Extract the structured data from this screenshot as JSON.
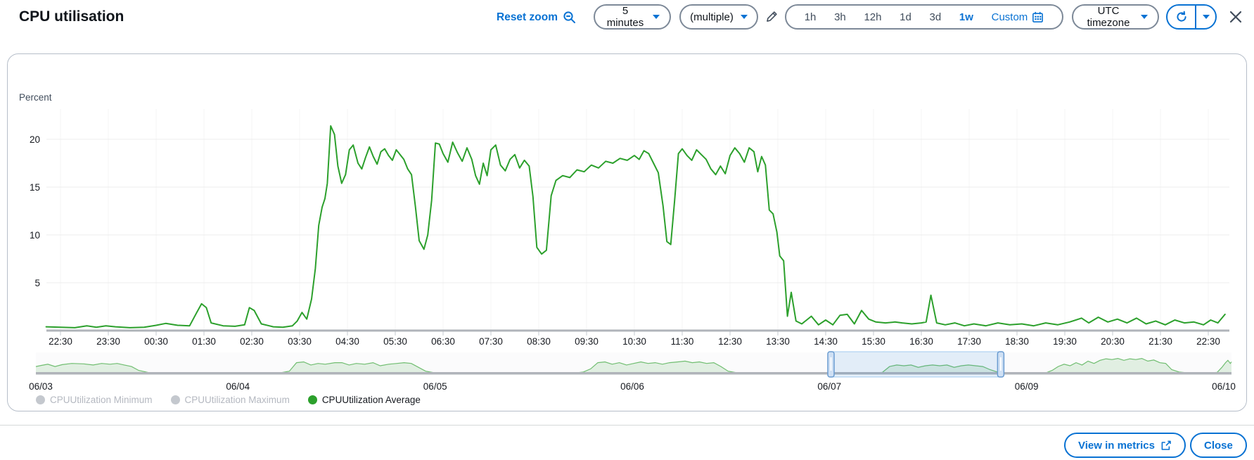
{
  "header": {
    "title": "CPU utilisation",
    "reset_zoom_label": "Reset zoom",
    "period_value": "5 minutes",
    "metric_value": "(multiple)",
    "time_ranges": [
      "1h",
      "3h",
      "12h",
      "1d",
      "3d",
      "1w"
    ],
    "active_time_range": "1w",
    "custom_label": "Custom",
    "timezone_value": "UTC timezone"
  },
  "chart_data": {
    "type": "line",
    "title": "CPU utilisation",
    "ylabel": "Percent",
    "y_ticks": [
      5,
      10,
      15,
      20
    ],
    "ylim": [
      0,
      27
    ],
    "grid": true,
    "legend_position": "bottom",
    "x_hours_range": [
      -0.3,
      24.35
    ],
    "x_tick_labels": [
      "22:30",
      "23:30",
      "00:30",
      "01:30",
      "02:30",
      "03:30",
      "04:30",
      "05:30",
      "06:30",
      "07:30",
      "08:30",
      "09:30",
      "10:30",
      "11:30",
      "12:30",
      "13:30",
      "14:30",
      "15:30",
      "16:30",
      "17:30",
      "18:30",
      "19:30",
      "20:30",
      "21:30",
      "22:30"
    ],
    "series": [
      {
        "name": "CPUUtilization Average",
        "unit": "Percent",
        "color": "#2ca02c",
        "points": [
          [
            -0.3,
            0.4
          ],
          [
            0,
            0.35
          ],
          [
            0.3,
            0.3
          ],
          [
            0.55,
            0.5
          ],
          [
            0.75,
            0.35
          ],
          [
            0.95,
            0.5
          ],
          [
            1.15,
            0.4
          ],
          [
            1.45,
            0.3
          ],
          [
            1.75,
            0.35
          ],
          [
            2,
            0.55
          ],
          [
            2.2,
            0.75
          ],
          [
            2.45,
            0.55
          ],
          [
            2.7,
            0.5
          ],
          [
            2.85,
            1.9
          ],
          [
            2.95,
            2.8
          ],
          [
            3.05,
            2.4
          ],
          [
            3.15,
            0.8
          ],
          [
            3.4,
            0.5
          ],
          [
            3.65,
            0.45
          ],
          [
            3.85,
            0.6
          ],
          [
            3.95,
            2.4
          ],
          [
            4.05,
            2.1
          ],
          [
            4.2,
            0.7
          ],
          [
            4.45,
            0.4
          ],
          [
            4.65,
            0.35
          ],
          [
            4.85,
            0.5
          ],
          [
            4.95,
            1
          ],
          [
            5.05,
            1.9
          ],
          [
            5.15,
            1.2
          ],
          [
            5.25,
            3.3
          ],
          [
            5.33,
            6.5
          ],
          [
            5.4,
            11
          ],
          [
            5.47,
            12.9
          ],
          [
            5.53,
            13.8
          ],
          [
            5.58,
            15.4
          ],
          [
            5.65,
            21.4
          ],
          [
            5.73,
            20.5
          ],
          [
            5.8,
            17.2
          ],
          [
            5.88,
            15.4
          ],
          [
            5.96,
            16.3
          ],
          [
            6.04,
            18.9
          ],
          [
            6.12,
            19.4
          ],
          [
            6.22,
            17.5
          ],
          [
            6.3,
            16.9
          ],
          [
            6.38,
            18.1
          ],
          [
            6.46,
            19.2
          ],
          [
            6.54,
            18.2
          ],
          [
            6.62,
            17.4
          ],
          [
            6.7,
            18.7
          ],
          [
            6.78,
            19
          ],
          [
            6.86,
            18.3
          ],
          [
            6.94,
            17.8
          ],
          [
            7.02,
            18.9
          ],
          [
            7.1,
            18.4
          ],
          [
            7.18,
            17.9
          ],
          [
            7.26,
            16.9
          ],
          [
            7.34,
            16.3
          ],
          [
            7.42,
            13
          ],
          [
            7.5,
            9.4
          ],
          [
            7.6,
            8.5
          ],
          [
            7.68,
            10
          ],
          [
            7.76,
            13.6
          ],
          [
            7.84,
            19.6
          ],
          [
            7.92,
            19.5
          ],
          [
            8,
            18.5
          ],
          [
            8.1,
            17.6
          ],
          [
            8.2,
            19.7
          ],
          [
            8.3,
            18.6
          ],
          [
            8.4,
            17.7
          ],
          [
            8.5,
            19.1
          ],
          [
            8.6,
            17.9
          ],
          [
            8.68,
            16.2
          ],
          [
            8.76,
            15.3
          ],
          [
            8.84,
            17.5
          ],
          [
            8.92,
            16.2
          ],
          [
            9,
            18.9
          ],
          [
            9.1,
            19.4
          ],
          [
            9.2,
            17.3
          ],
          [
            9.3,
            16.7
          ],
          [
            9.4,
            17.9
          ],
          [
            9.5,
            18.4
          ],
          [
            9.6,
            17
          ],
          [
            9.7,
            17.8
          ],
          [
            9.8,
            17.2
          ],
          [
            9.88,
            14
          ],
          [
            9.96,
            8.7
          ],
          [
            10.06,
            8
          ],
          [
            10.16,
            8.4
          ],
          [
            10.26,
            14.1
          ],
          [
            10.36,
            15.7
          ],
          [
            10.5,
            16.2
          ],
          [
            10.65,
            16
          ],
          [
            10.8,
            16.8
          ],
          [
            10.95,
            16.6
          ],
          [
            11.1,
            17.3
          ],
          [
            11.25,
            17
          ],
          [
            11.4,
            17.7
          ],
          [
            11.55,
            17.5
          ],
          [
            11.7,
            18
          ],
          [
            11.85,
            17.8
          ],
          [
            12,
            18.3
          ],
          [
            12.1,
            17.9
          ],
          [
            12.2,
            18.8
          ],
          [
            12.3,
            18.5
          ],
          [
            12.4,
            17.5
          ],
          [
            12.5,
            16.5
          ],
          [
            12.6,
            13
          ],
          [
            12.68,
            9.3
          ],
          [
            12.76,
            9
          ],
          [
            12.84,
            13.5
          ],
          [
            12.92,
            18.5
          ],
          [
            13,
            19
          ],
          [
            13.1,
            18.3
          ],
          [
            13.2,
            17.8
          ],
          [
            13.3,
            18.9
          ],
          [
            13.4,
            18.4
          ],
          [
            13.5,
            17.9
          ],
          [
            13.6,
            16.9
          ],
          [
            13.7,
            16.3
          ],
          [
            13.8,
            17.2
          ],
          [
            13.9,
            16.4
          ],
          [
            14,
            18.3
          ],
          [
            14.1,
            19.1
          ],
          [
            14.2,
            18.5
          ],
          [
            14.3,
            17.6
          ],
          [
            14.4,
            19.1
          ],
          [
            14.5,
            18.7
          ],
          [
            14.58,
            16.6
          ],
          [
            14.66,
            18.2
          ],
          [
            14.74,
            17.3
          ],
          [
            14.82,
            12.6
          ],
          [
            14.9,
            12.2
          ],
          [
            14.98,
            10.3
          ],
          [
            15.04,
            7.8
          ],
          [
            15.12,
            7.3
          ],
          [
            15.2,
            1.5
          ],
          [
            15.28,
            4
          ],
          [
            15.38,
            1
          ],
          [
            15.5,
            0.7
          ],
          [
            15.7,
            1.5
          ],
          [
            15.85,
            0.6
          ],
          [
            16,
            1.1
          ],
          [
            16.15,
            0.6
          ],
          [
            16.3,
            1.6
          ],
          [
            16.45,
            1.7
          ],
          [
            16.6,
            0.7
          ],
          [
            16.75,
            2.1
          ],
          [
            16.9,
            1.2
          ],
          [
            17.05,
            0.9
          ],
          [
            17.25,
            0.8
          ],
          [
            17.45,
            0.9
          ],
          [
            17.6,
            0.8
          ],
          [
            17.8,
            0.7
          ],
          [
            18,
            0.8
          ],
          [
            18.1,
            0.9
          ],
          [
            18.2,
            3.7
          ],
          [
            18.32,
            0.8
          ],
          [
            18.5,
            0.6
          ],
          [
            18.7,
            0.8
          ],
          [
            18.9,
            0.5
          ],
          [
            19.1,
            0.7
          ],
          [
            19.35,
            0.5
          ],
          [
            19.6,
            0.8
          ],
          [
            19.85,
            0.6
          ],
          [
            20.1,
            0.7
          ],
          [
            20.35,
            0.5
          ],
          [
            20.6,
            0.8
          ],
          [
            20.85,
            0.6
          ],
          [
            21.1,
            0.9
          ],
          [
            21.35,
            1.3
          ],
          [
            21.5,
            0.8
          ],
          [
            21.7,
            1.4
          ],
          [
            21.9,
            0.9
          ],
          [
            22.1,
            1.2
          ],
          [
            22.3,
            0.8
          ],
          [
            22.5,
            1.3
          ],
          [
            22.7,
            0.7
          ],
          [
            22.9,
            1
          ],
          [
            23.1,
            0.6
          ],
          [
            23.3,
            1.1
          ],
          [
            23.5,
            0.8
          ],
          [
            23.7,
            0.9
          ],
          [
            23.9,
            0.6
          ],
          [
            24.05,
            1.1
          ],
          [
            24.2,
            0.8
          ],
          [
            24.35,
            1.7
          ]
        ]
      }
    ],
    "timeline": {
      "date_labels": [
        "06/03",
        "06/04",
        "06/05",
        "06/06",
        "06/07",
        "06/09",
        "06/10"
      ],
      "selected_range_fracs": [
        0.665,
        0.807
      ],
      "sparkline_points": [
        [
          0,
          9
        ],
        [
          0.005,
          10.5
        ],
        [
          0.01,
          12
        ],
        [
          0.016,
          9
        ],
        [
          0.022,
          11.5
        ],
        [
          0.03,
          13
        ],
        [
          0.04,
          12.5
        ],
        [
          0.048,
          11
        ],
        [
          0.055,
          13
        ],
        [
          0.062,
          12
        ],
        [
          0.068,
          13
        ],
        [
          0.074,
          11
        ],
        [
          0.08,
          9
        ],
        [
          0.086,
          4
        ],
        [
          0.095,
          1
        ],
        [
          0.12,
          0.5
        ],
        [
          0.18,
          0.5
        ],
        [
          0.205,
          1
        ],
        [
          0.212,
          3
        ],
        [
          0.218,
          14
        ],
        [
          0.224,
          15
        ],
        [
          0.23,
          11
        ],
        [
          0.236,
          13
        ],
        [
          0.242,
          12
        ],
        [
          0.25,
          14
        ],
        [
          0.256,
          14
        ],
        [
          0.262,
          11
        ],
        [
          0.268,
          13
        ],
        [
          0.275,
          12
        ],
        [
          0.282,
          14
        ],
        [
          0.288,
          10
        ],
        [
          0.295,
          12
        ],
        [
          0.302,
          13
        ],
        [
          0.308,
          14
        ],
        [
          0.314,
          13
        ],
        [
          0.32,
          8
        ],
        [
          0.326,
          3
        ],
        [
          0.333,
          1
        ],
        [
          0.34,
          0.5
        ],
        [
          0.4,
          0.5
        ],
        [
          0.452,
          0.8
        ],
        [
          0.458,
          2
        ],
        [
          0.464,
          6
        ],
        [
          0.47,
          14
        ],
        [
          0.476,
          15
        ],
        [
          0.482,
          12
        ],
        [
          0.488,
          14
        ],
        [
          0.494,
          11
        ],
        [
          0.5,
          13
        ],
        [
          0.506,
          15
        ],
        [
          0.512,
          13
        ],
        [
          0.518,
          14
        ],
        [
          0.524,
          12
        ],
        [
          0.53,
          14
        ],
        [
          0.537,
          15
        ],
        [
          0.543,
          16
        ],
        [
          0.549,
          14
        ],
        [
          0.555,
          15
        ],
        [
          0.561,
          13
        ],
        [
          0.567,
          14
        ],
        [
          0.573,
          9
        ],
        [
          0.579,
          3
        ],
        [
          0.586,
          1
        ],
        [
          0.593,
          0.5
        ],
        [
          0.65,
          0.5
        ],
        [
          0.702,
          0.7
        ],
        [
          0.708,
          1.5
        ],
        [
          0.714,
          9
        ],
        [
          0.72,
          11
        ],
        [
          0.726,
          10
        ],
        [
          0.732,
          11
        ],
        [
          0.738,
          8
        ],
        [
          0.744,
          10
        ],
        [
          0.75,
          11
        ],
        [
          0.756,
          10
        ],
        [
          0.762,
          11
        ],
        [
          0.768,
          8
        ],
        [
          0.774,
          10
        ],
        [
          0.78,
          11
        ],
        [
          0.786,
          10
        ],
        [
          0.792,
          9
        ],
        [
          0.798,
          5
        ],
        [
          0.804,
          2
        ],
        [
          0.81,
          0.7
        ],
        [
          0.83,
          0.5
        ],
        [
          0.845,
          1
        ],
        [
          0.85,
          4
        ],
        [
          0.855,
          9
        ],
        [
          0.86,
          12
        ],
        [
          0.865,
          10
        ],
        [
          0.87,
          14
        ],
        [
          0.875,
          11
        ],
        [
          0.88,
          16
        ],
        [
          0.885,
          13
        ],
        [
          0.89,
          17
        ],
        [
          0.895,
          19
        ],
        [
          0.9,
          18
        ],
        [
          0.905,
          19.5
        ],
        [
          0.91,
          17
        ],
        [
          0.915,
          19
        ],
        [
          0.92,
          18
        ],
        [
          0.925,
          19.5
        ],
        [
          0.93,
          16
        ],
        [
          0.935,
          17.5
        ],
        [
          0.94,
          14
        ],
        [
          0.945,
          13
        ],
        [
          0.95,
          5
        ],
        [
          0.956,
          2
        ],
        [
          0.962,
          1
        ],
        [
          0.97,
          0.5
        ],
        [
          0.982,
          0.6
        ],
        [
          0.988,
          1.5
        ],
        [
          0.992,
          8
        ],
        [
          0.995,
          14
        ],
        [
          0.997,
          17
        ],
        [
          0.999,
          13
        ],
        [
          1,
          15
        ]
      ]
    }
  },
  "legend": {
    "items": [
      {
        "label": "CPUUtilization Minimum",
        "color": "#c4c8ce",
        "dimmed": true
      },
      {
        "label": "CPUUtilization Maximum",
        "color": "#c4c8ce",
        "dimmed": true
      },
      {
        "label": "CPUUtilization Average",
        "color": "#2ca02c",
        "dimmed": false
      }
    ]
  },
  "footer": {
    "view_in_metrics_label": "View in metrics",
    "close_label": "Close"
  },
  "colors": {
    "accent": "#0972d3",
    "line_green": "#2ca02c",
    "axis_text": "#16191f",
    "dim_text": "#b4b8c0",
    "control_border": "#7d8998",
    "card_border": "#b6bec9",
    "grid_line": "#ececec",
    "baseline": "#b0b4ba",
    "selection_fill": "rgba(9,114,211,0.10)",
    "selection_border": "rgba(9,114,211,0.35)",
    "selection_handle_border": "#6a9cd1",
    "selection_handle_fill": "#cfe0f4"
  }
}
